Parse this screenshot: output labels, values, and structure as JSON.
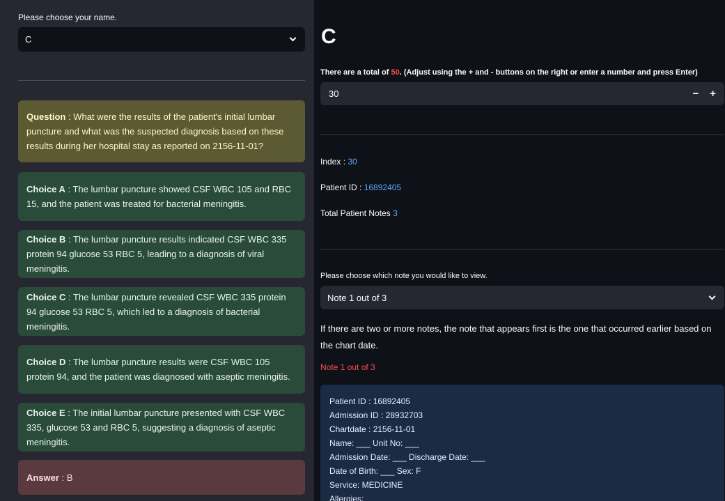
{
  "sidebar": {
    "name_label": "Please choose your name.",
    "name_value": "C",
    "question": {
      "label": "Question",
      "text": "What were the results of the patient's initial lumbar puncture and what was the suspected diagnosis based on these results during her hospital stay as reported on 2156-11-01?"
    },
    "choices": [
      {
        "label": "Choice A",
        "text": "The lumbar puncture showed CSF WBC 105 and RBC 15, and the patient was treated for bacterial meningitis."
      },
      {
        "label": "Choice B",
        "text": "The lumbar puncture results indicated CSF WBC 335 protein 94 glucose 53 RBC 5, leading to a diagnosis of viral meningitis."
      },
      {
        "label": "Choice C",
        "text": "The lumbar puncture revealed CSF WBC 335 protein 94 glucose 53 RBC 5, which led to a diagnosis of bacterial meningitis."
      },
      {
        "label": "Choice D",
        "text": "The lumbar puncture results were CSF WBC 105 protein 94, and the patient was diagnosed with aseptic meningitis."
      },
      {
        "label": "Choice E",
        "text": "The initial lumbar puncture presented with CSF WBC 335, glucose 53 and RBC 5, suggesting a diagnosis of aseptic meningitis."
      }
    ],
    "answer": {
      "label": "Answer",
      "text": "B"
    },
    "separator": " : "
  },
  "main": {
    "title": "C",
    "total_prefix": "There are a total of ",
    "total_value": "50",
    "total_suffix": ". (Adjust using the + and - buttons on the right or enter a number and press Enter)",
    "number_value": "30",
    "minus": "−",
    "plus": "+",
    "index_label": "Index : ",
    "index_value": "30",
    "patient_id_label": "Patient ID : ",
    "patient_id_value": "16892405",
    "total_notes_label": "Total Patient Notes ",
    "total_notes_value": "3",
    "note_choose_label": "Please choose which note you would like to view.",
    "note_select_value": "Note 1 out of 3",
    "explanation": "If there are two or more notes, the note that appears first is the one that occurred earlier based on the chart date.",
    "note_heading": "Note 1 out of 3",
    "note_lines": [
      "Patient ID : 16892405",
      "Admission ID : 28932703",
      "Chartdate : 2156-11-01",
      "Name: ___ Unit No: ___",
      "Admission Date: ___ Discharge Date: ___",
      "Date of Birth: ___ Sex: F",
      "Service: MEDICINE",
      "Allergies:"
    ]
  },
  "colors": {
    "accent_red": "#ff4b4b",
    "link_blue": "#5aa7ff",
    "question_bg": "#5c5a33",
    "choice_bg": "#2a4a3a",
    "answer_bg": "#5a3a3e",
    "note_bg": "#1c2b44"
  },
  "icons": {
    "dropdown": "chevron-down-icon",
    "decrement": "minus-icon",
    "increment": "plus-icon"
  }
}
